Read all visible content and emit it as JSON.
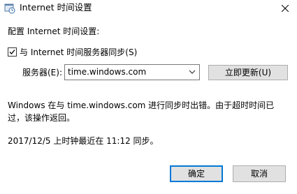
{
  "window": {
    "title": "Internet 时间设置",
    "icon": "clock-settings-icon"
  },
  "heading": "配置 Internet 时间设置:",
  "sync": {
    "checked": true,
    "label": "与 Internet 时间服务器同步(S)"
  },
  "server": {
    "label": "服务器(E):",
    "value": "time.windows.com"
  },
  "buttons": {
    "update": "立即更新(U)",
    "ok": "确定",
    "cancel": "取消"
  },
  "status": {
    "error": "Windows 在与 time.windows.com 进行同步时出错。由于超时时间已过，该操作返回。",
    "last_sync": "2017/12/5 上时钟最近在 11:12 同步。"
  },
  "colors": {
    "accent": "#0078d7",
    "button_bg": "#e1e1e1",
    "button_border": "#adadad"
  }
}
